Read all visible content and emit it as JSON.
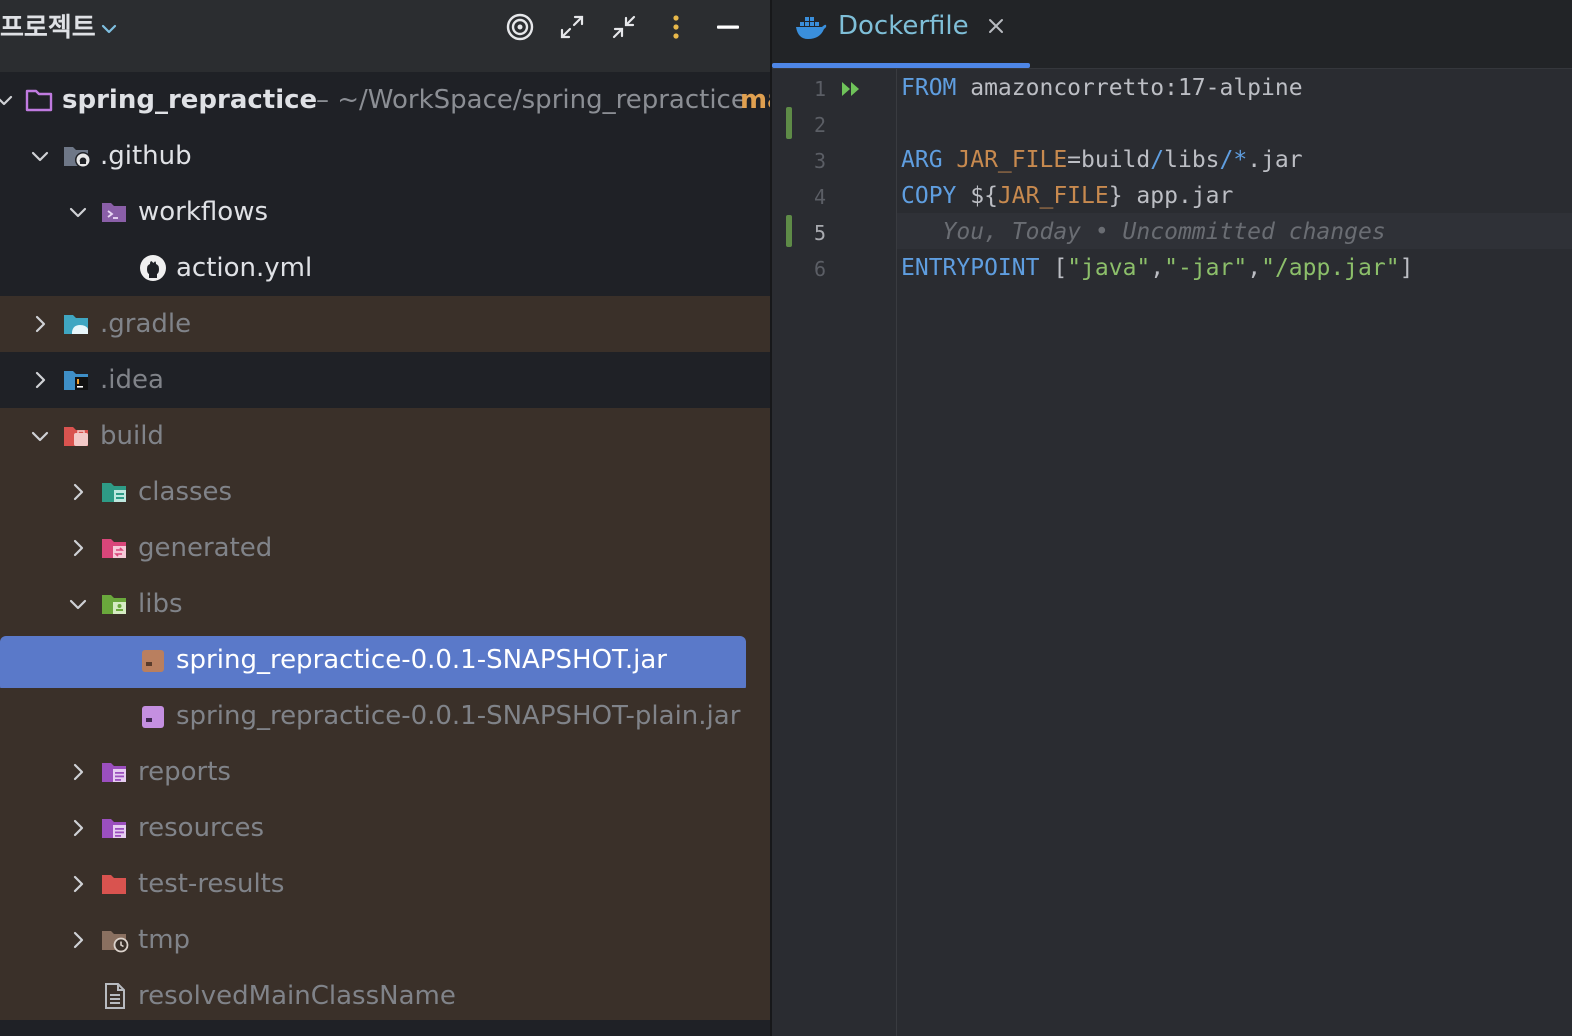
{
  "project_panel": {
    "title": "프로젝트",
    "root": {
      "name": "spring_repractice",
      "path": "– ~/WorkSpace/spring_repractice",
      "branch": "ma"
    },
    "tree": [
      {
        "label": "spring_repractice"
      },
      {
        "label": ".github"
      },
      {
        "label": "workflows"
      },
      {
        "label": "action.yml"
      },
      {
        "label": ".gradle"
      },
      {
        "label": ".idea"
      },
      {
        "label": "build"
      },
      {
        "label": "classes"
      },
      {
        "label": "generated"
      },
      {
        "label": "libs"
      },
      {
        "label": "spring_repractice-0.0.1-SNAPSHOT.jar"
      },
      {
        "label": "spring_repractice-0.0.1-SNAPSHOT-plain.jar"
      },
      {
        "label": "reports"
      },
      {
        "label": "resources"
      },
      {
        "label": "test-results"
      },
      {
        "label": "tmp"
      },
      {
        "label": "resolvedMainClassName"
      }
    ]
  },
  "editor": {
    "tab_label": "Dockerfile",
    "line_numbers": [
      "1",
      "2",
      "3",
      "4",
      "5",
      "6"
    ],
    "lines": {
      "l1_kw": "FROM",
      "l1_rest": " amazoncorretto:17-alpine",
      "l3_kw": "ARG",
      "l3_var": " JAR_FILE",
      "l3_eq": "=build",
      "l3_slash1": "/",
      "l3_libs": "libs",
      "l3_slash2": "/*",
      "l3_ext": ".jar",
      "l4_kw": "COPY",
      "l4_open": " ${",
      "l4_var": "JAR_FILE",
      "l4_close": "} app.jar",
      "l5_blame": "   You, Today • Uncommitted changes",
      "l6_kw": "ENTRYPOINT",
      "l6_open": " [",
      "l6_s1": "\"java\"",
      "l6_c1": ",",
      "l6_s2": "\"-jar\"",
      "l6_c2": ",",
      "l6_s3": "\"/app.jar\"",
      "l6_close": "]"
    }
  },
  "colors": {
    "selection": "#5a79c9",
    "excluded_bg": "#3a3029",
    "tab_accent": "#4e86e6",
    "keyword": "#5f9ee0",
    "string": "#8cbf6a",
    "variable": "#c88a4f"
  }
}
